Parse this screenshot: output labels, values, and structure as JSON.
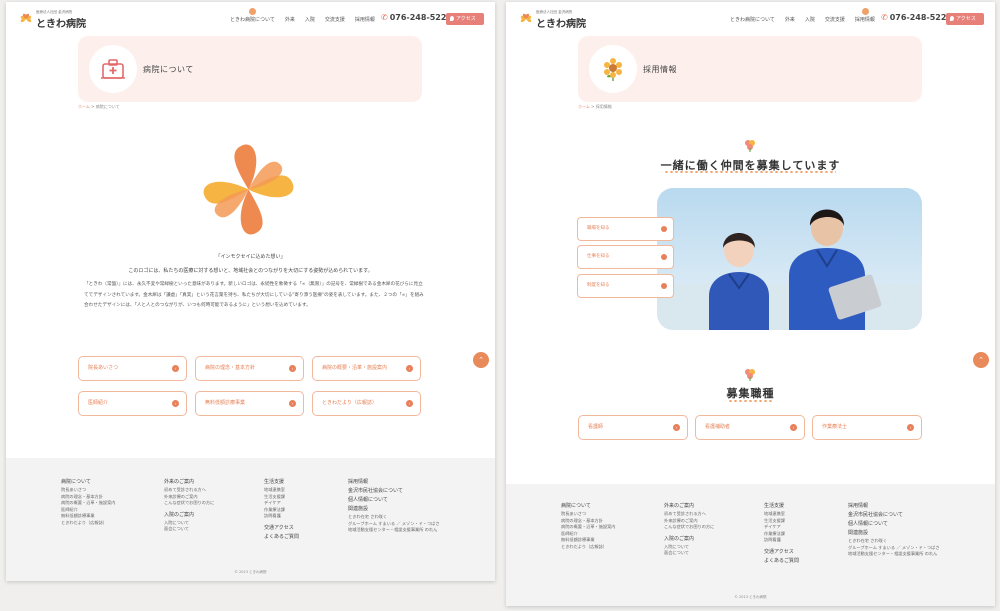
{
  "site": {
    "corp_name": "医療法人社団 金沢病院",
    "hospital_name": "ときわ病院",
    "nav": [
      "ときわ病院について",
      "外来",
      "入院",
      "交流支援",
      "採用情報"
    ],
    "phone": "076-248-5221",
    "access_label": "アクセス"
  },
  "colors": {
    "accent": "#e8805a",
    "hero_bg": "#fdf0ec",
    "border": "#f1b89c",
    "access_btn": "#e8807a"
  },
  "left_page": {
    "hero_title": "病院について",
    "hero_icon": "hospital-building-icon",
    "breadcrumb": {
      "home": "ホーム",
      "current": "病院について"
    },
    "logo_caption": "「インモクセイに込めた想い」",
    "intro": "このロゴには、私たちの医療に対する想いと、地域社会とのつながりを大切にする姿勢が込められています。",
    "body": "「ときわ（常盤）」には、永久不変や常緑樹といった意味があります。新しいロゴは、永続性を象徴する「∞（無限）」の記号を、常緑樹である金木犀の花びらに見立ててデザインされています。金木犀は「謙虚」「真実」という花言葉を持ち、私たちが大切にしている\"寄り添う医療\"の姿を表しています。また、２つの「∞」を組み合わせたデザインには、「人と人とのつながりが、いつも何時可能であるように」という想いを込めています。",
    "buttons": [
      "院長あいさつ",
      "病院の理念・基本方針",
      "病院の概要・沿革・施設案内",
      "医師紹介",
      "無料低額診療事業",
      "ときわだより（広報誌）"
    ]
  },
  "right_page": {
    "hero_title": "採用情報",
    "hero_icon": "sunflower-icon",
    "breadcrumb": {
      "home": "ホーム",
      "current": "採用情報"
    },
    "headline": "一緒に働く仲間を募集しています",
    "side_buttons": [
      "職場を知る",
      "仕事を知る",
      "制度を知る"
    ],
    "section_title": "募集職種",
    "job_buttons": [
      "看護師",
      "看護補助者",
      "作業療法士"
    ]
  },
  "footer": {
    "col1": {
      "title": "病院について",
      "items": [
        "院長あいさつ",
        "病院の理念・基本方針",
        "病院の概要・沿革・施設案内",
        "医師紹介",
        "無料低額診療事業",
        "ときわだより（広報誌）"
      ]
    },
    "col2": {
      "title": "外来のご案内",
      "items": [
        "初めて受診される方へ",
        "外来診療のご案内",
        "こんな症状でお困りの方に"
      ],
      "title2": "入院のご案内",
      "items2": [
        "入院について",
        "面会について"
      ]
    },
    "col3": {
      "title": "生活支援",
      "items": [
        "地域連携室",
        "生活支援課",
        "デイケア",
        "作業療法課",
        "訪問看護"
      ],
      "title2": "交通アクセス",
      "title3": "よくあるご質問"
    },
    "col4": {
      "title": "採用情報",
      "link1": "金沢市民社協会について",
      "link2": "個人情報について",
      "related_title": "関連施設",
      "rel1": "ときわ在宅 さわ咲く",
      "rel2": "グループホーム すまいる ／ メゾン・ド・つばさ",
      "rel3": "地域活動支援センター・相談支援事業所 のれん"
    },
    "copyright": "© 2013 ときわ病院"
  }
}
